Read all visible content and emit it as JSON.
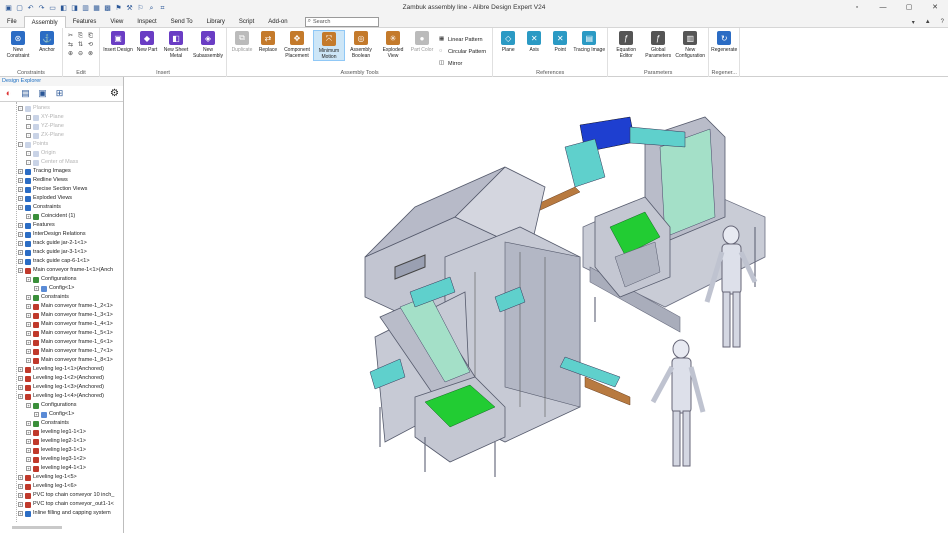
{
  "window": {
    "title": "Zambuk assembly line - Alibre Design Expert V24"
  },
  "quick_access": [
    "save-icon",
    "open-icon",
    "undo-icon",
    "redo-icon",
    "new-icon",
    "part-icon",
    "assembly-icon",
    "sheet-icon",
    "drawing-icon",
    "grid-icon",
    "options-icon",
    "measure-icon",
    "select-icon",
    "search-icon",
    "zoom-icon"
  ],
  "menu": {
    "items": [
      "File",
      "Assembly",
      "Features",
      "View",
      "Inspect",
      "Send To",
      "Library",
      "Script",
      "Add-on"
    ],
    "active": "Assembly",
    "search_placeholder": "Search"
  },
  "ribbon": {
    "groups": [
      {
        "label": "Constraints",
        "tools": [
          "New Constraint",
          "Anchor"
        ]
      },
      {
        "label": "Edit",
        "tools": []
      },
      {
        "label": "Insert",
        "tools": [
          "Insert Design",
          "New Part",
          "New Sheet Metal",
          "New Subassembly"
        ]
      },
      {
        "label": "Assembly Tools",
        "tools": [
          "Duplicate",
          "Replace",
          "Component Placement",
          "Minimum Motion",
          "Assembly Boolean",
          "Exploded View",
          "Part Color"
        ],
        "row_tools": [
          "Linear Pattern",
          "Circular Pattern",
          "Mirror"
        ]
      },
      {
        "label": "References",
        "tools": [
          "Plane",
          "Axis",
          "Point",
          "Tracing Image"
        ]
      },
      {
        "label": "Parameters",
        "tools": [
          "Equation Editor",
          "Global Parameters",
          "New Configuration"
        ]
      },
      {
        "label": "Regener...",
        "tools": [
          "Regenerate"
        ]
      }
    ]
  },
  "explorer": {
    "title": "Design Explorer",
    "items": [
      {
        "label": "Planes",
        "grey": true,
        "indent": 1
      },
      {
        "label": "XY-Plane",
        "grey": true,
        "indent": 2
      },
      {
        "label": "YZ-Plane",
        "grey": true,
        "indent": 2
      },
      {
        "label": "ZX-Plane",
        "grey": true,
        "indent": 2
      },
      {
        "label": "Points",
        "grey": true,
        "indent": 1
      },
      {
        "label": "Origin",
        "grey": true,
        "indent": 2
      },
      {
        "label": "Center of Mass",
        "grey": true,
        "indent": 2
      },
      {
        "label": "Tracing Images",
        "indent": 1
      },
      {
        "label": "Redline Views",
        "indent": 1
      },
      {
        "label": "Precise Section Views",
        "indent": 1
      },
      {
        "label": "Exploded Views",
        "indent": 1
      },
      {
        "label": "Constraints",
        "indent": 1
      },
      {
        "label": "Coincident (1)",
        "indent": 2
      },
      {
        "label": "Features",
        "indent": 1
      },
      {
        "label": "InterDesign Relations",
        "indent": 1
      },
      {
        "label": "track guide jar-2-1<1>",
        "indent": 1
      },
      {
        "label": "track guide jar-3-1<1>",
        "indent": 1
      },
      {
        "label": "track guide cap-6-1<1>",
        "indent": 1
      },
      {
        "label": "Main conveyor frame-1<1>(Anch",
        "indent": 1
      },
      {
        "label": "Configurations",
        "indent": 2
      },
      {
        "label": "Config<1>",
        "indent": 3
      },
      {
        "label": "Constraints",
        "indent": 2
      },
      {
        "label": "Main conveyor frame-1_2<1>",
        "indent": 2
      },
      {
        "label": "Main conveyor frame-1_3<1>",
        "indent": 2
      },
      {
        "label": "Main conveyor frame-1_4<1>",
        "indent": 2
      },
      {
        "label": "Main conveyor frame-1_5<1>",
        "indent": 2
      },
      {
        "label": "Main conveyor frame-1_6<1>",
        "indent": 2
      },
      {
        "label": "Main conveyor frame-1_7<1>",
        "indent": 2
      },
      {
        "label": "Main conveyor frame-1_8<1>",
        "indent": 2
      },
      {
        "label": "Leveling leg-1<1>(Anchored)",
        "indent": 1
      },
      {
        "label": "Leveling leg-1<2>(Anchored)",
        "indent": 1
      },
      {
        "label": "Leveling leg-1<3>(Anchored)",
        "indent": 1
      },
      {
        "label": "Leveling leg-1<4>(Anchored)",
        "indent": 1
      },
      {
        "label": "Configurations",
        "indent": 2
      },
      {
        "label": "Config<1>",
        "indent": 3
      },
      {
        "label": "Constraints",
        "indent": 2
      },
      {
        "label": "leveling leg1-1<1>",
        "indent": 2
      },
      {
        "label": "leveling leg2-1<1>",
        "indent": 2
      },
      {
        "label": "leveling leg3-1<1>",
        "indent": 2
      },
      {
        "label": "leveling leg3-1<2>",
        "indent": 2
      },
      {
        "label": "leveling leg4-1<1>",
        "indent": 2
      },
      {
        "label": "Leveling leg-1<5>",
        "indent": 1
      },
      {
        "label": "Leveling leg-1<6>",
        "indent": 1
      },
      {
        "label": "PVC top chain conveyor 10 inch_",
        "indent": 1
      },
      {
        "label": "PVC top chain conveyor_out1-1<",
        "indent": 1
      },
      {
        "label": "Inline filling  and capping system",
        "indent": 1
      }
    ]
  },
  "colors": {
    "accent": "#1a6dc2",
    "machine_grey": "#b8bcc8",
    "machine_green": "#22cc33",
    "machine_teal": "#5fd0cc",
    "machine_blue": "#1e3fd0"
  }
}
